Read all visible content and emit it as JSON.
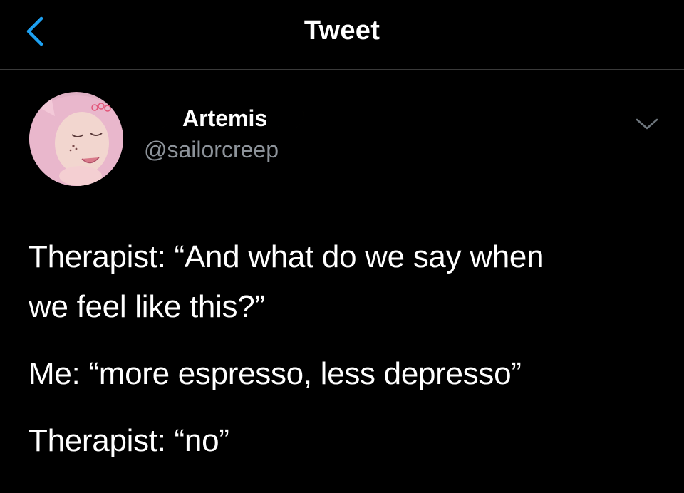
{
  "header": {
    "title": "Tweet",
    "back_icon": "chevron-left-icon"
  },
  "author": {
    "avatar_icon": "profile-avatar",
    "name_prefix_icon": "crescent-moon-icon",
    "name": "Artemis",
    "name_suffix_icon": "crescent-moon-icon",
    "handle": "@sailorcreep"
  },
  "menu": {
    "icon": "chevron-down-icon"
  },
  "tweet": {
    "lines": [
      "Therapist: “And what do we say when",
      "we feel like this?”",
      "Me: “more espresso, less depresso”",
      "Therapist: “no”"
    ]
  },
  "colors": {
    "background": "#000000",
    "text": "#ffffff",
    "secondary_text": "#8d939a",
    "accent": "#1da1f2",
    "moon": "#f5cf3c",
    "divider": "#3a3a3a"
  }
}
